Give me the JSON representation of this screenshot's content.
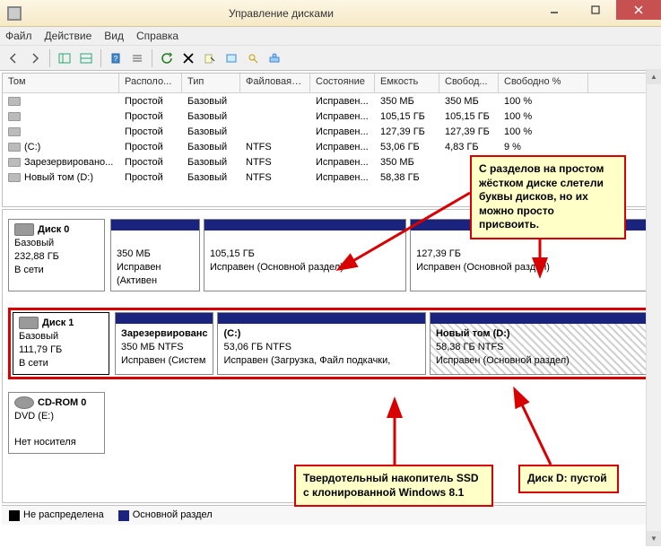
{
  "window": {
    "title": "Управление дисками"
  },
  "menu": {
    "file": "Файл",
    "action": "Действие",
    "view": "Вид",
    "help": "Справка"
  },
  "columns": [
    "Том",
    "Располо...",
    "Тип",
    "Файловая с...",
    "Состояние",
    "Емкость",
    "Свобод...",
    "Свободно %"
  ],
  "volumes": [
    {
      "name": "",
      "layout": "Простой",
      "type": "Базовый",
      "fs": "",
      "status": "Исправен...",
      "cap": "350 МБ",
      "free": "350 МБ",
      "pct": "100 %"
    },
    {
      "name": "",
      "layout": "Простой",
      "type": "Базовый",
      "fs": "",
      "status": "Исправен...",
      "cap": "105,15 ГБ",
      "free": "105,15 ГБ",
      "pct": "100 %"
    },
    {
      "name": "",
      "layout": "Простой",
      "type": "Базовый",
      "fs": "",
      "status": "Исправен...",
      "cap": "127,39 ГБ",
      "free": "127,39 ГБ",
      "pct": "100 %"
    },
    {
      "name": "(C:)",
      "layout": "Простой",
      "type": "Базовый",
      "fs": "NTFS",
      "status": "Исправен...",
      "cap": "53,06 ГБ",
      "free": "4,83 ГБ",
      "pct": "9 %"
    },
    {
      "name": "Зарезервировано...",
      "layout": "Простой",
      "type": "Базовый",
      "fs": "NTFS",
      "status": "Исправен...",
      "cap": "350 МБ",
      "free": "",
      "pct": ""
    },
    {
      "name": "Новый том (D:)",
      "layout": "Простой",
      "type": "Базовый",
      "fs": "NTFS",
      "status": "Исправен...",
      "cap": "58,38 ГБ",
      "free": "",
      "pct": ""
    }
  ],
  "disk0": {
    "name": "Диск 0",
    "type": "Базовый",
    "size": "232,88 ГБ",
    "status": "В сети",
    "parts": [
      {
        "line1": "",
        "line2": "350 МБ",
        "line3": "Исправен (Активен"
      },
      {
        "line1": "",
        "line2": "105,15 ГБ",
        "line3": "Исправен (Основной раздел)"
      },
      {
        "line1": "",
        "line2": "127,39 ГБ",
        "line3": "Исправен (Основной раздел)"
      }
    ]
  },
  "disk1": {
    "name": "Диск 1",
    "type": "Базовый",
    "size": "111,79 ГБ",
    "status": "В сети",
    "parts": [
      {
        "line1": "Зарезервированс",
        "line2": "350 МБ NTFS",
        "line3": "Исправен (Систем"
      },
      {
        "line1": "(C:)",
        "line2": "53,06 ГБ NTFS",
        "line3": "Исправен (Загрузка, Файл подкачки,"
      },
      {
        "line1": "Новый том (D:)",
        "line2": "58,38 ГБ NTFS",
        "line3": "Исправен (Основной раздел)"
      }
    ]
  },
  "cdrom": {
    "name": "CD-ROM 0",
    "type": "DVD (E:)",
    "status": "Нет носителя"
  },
  "legend": {
    "unalloc": "Не распределена",
    "primary": "Основной раздел"
  },
  "annot": {
    "a1": "С разделов на простом жёстком диске слетели буквы дисков, но их можно просто присвоить.",
    "a2": "Твердотельный накопитель SSD с клонированной Windows 8.1",
    "a3": "Диск D: пустой"
  }
}
